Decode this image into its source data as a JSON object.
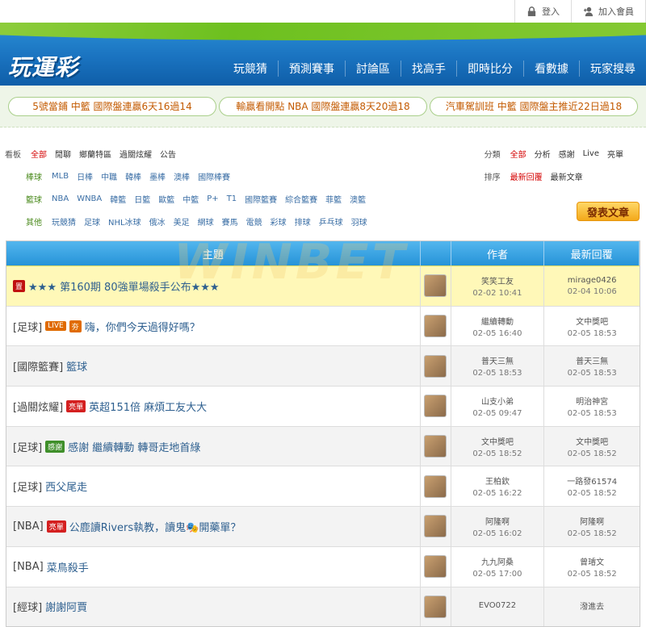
{
  "top": {
    "login": "登入",
    "register": "加入會員"
  },
  "header": {
    "logo": "玩運彩"
  },
  "nav": [
    "玩競猜",
    "預測賽事",
    "討論區",
    "找高手",
    "即時比分",
    "看數據",
    "玩家搜尋"
  ],
  "promos": [
    "5號當鋪 中籃 國際盤連贏6天16過14",
    "輸贏看開點 NBA 國際盤連贏8天20過18",
    "汽車駕訓班 中籃 國際盤主推近22日過18"
  ],
  "filters": {
    "board_label": "看板",
    "board": [
      "全部",
      "閒聊",
      "鄉蘭特區",
      "過關炫耀",
      "公告"
    ],
    "baseball_label": "棒球",
    "baseball": [
      "MLB",
      "日棒",
      "中職",
      "韓棒",
      "墨棒",
      "澳棒",
      "國際棒賽"
    ],
    "basketball_label": "籃球",
    "basketball": [
      "NBA",
      "WNBA",
      "韓籃",
      "日籃",
      "歐籃",
      "中籃",
      "P+",
      "T1",
      "國際籃賽",
      "綜合籃賽",
      "菲籃",
      "澳籃"
    ],
    "other_label": "其他",
    "other": [
      "玩競猜",
      "足球",
      "NHL冰球",
      "俄冰",
      "美足",
      "網球",
      "賽馬",
      "電競",
      "彩球",
      "排球",
      "乒乓球",
      "羽球"
    ],
    "class_label": "分類",
    "class": [
      "全部",
      "分析",
      "感謝",
      "Live",
      "亮單"
    ],
    "sort_label": "排序",
    "sort": [
      "最新回覆",
      "最新文章"
    ]
  },
  "post_button": "發表文章",
  "table": {
    "headers": [
      "主題",
      "",
      "作者",
      "最新回覆"
    ],
    "rows": [
      {
        "cat": "",
        "badges": [
          "置"
        ],
        "title": "★★★ 第160期 80強單場殺手公布★★★",
        "author": "笑笑工友",
        "author_time": "02-02 10:41",
        "reply": "mirage0426",
        "reply_time": "02-04 10:06"
      },
      {
        "cat": "[足球]",
        "badges": [
          "LIVE",
          "夯"
        ],
        "title": "嗨，你們今天過得好嗎？",
        "author": "繼續轉動",
        "author_time": "02-05 16:40",
        "reply": "文中獎吧",
        "reply_time": "02-05 18:53"
      },
      {
        "cat": "[國際籃賽]",
        "badges": [],
        "title": "籃球",
        "author": "普天三無",
        "author_time": "02-05 18:53",
        "reply": "普天三無",
        "reply_time": "02-05 18:53"
      },
      {
        "cat": "[過關炫耀]",
        "badges": [
          "亮單"
        ],
        "title": "英超151倍 麻煩工友大大",
        "author": "山支小弟",
        "author_time": "02-05 09:47",
        "reply": "明治神宮",
        "reply_time": "02-05 18:53"
      },
      {
        "cat": "[足球]",
        "badges": [
          "感謝"
        ],
        "title": "感謝 繼續轉動 轉哥走地首綠",
        "author": "文中獎吧",
        "author_time": "02-05 18:52",
        "reply": "文中獎吧",
        "reply_time": "02-05 18:52"
      },
      {
        "cat": "[足球]",
        "badges": [],
        "title": "西父尾走",
        "author": "王柏欽",
        "author_time": "02-05 16:22",
        "reply": "一路發61574",
        "reply_time": "02-05 18:52"
      },
      {
        "cat": "[NBA]",
        "badges": [
          "亮單"
        ],
        "title": "公鹿讀Rivers執教，讀鬼🎭開藥單？",
        "author": "阿隆啊",
        "author_time": "02-05 16:02",
        "reply": "阿隆啊",
        "reply_time": "02-05 18:52"
      },
      {
        "cat": "[NBA]",
        "badges": [],
        "title": "菜鳥殺手",
        "author": "九九阿桑",
        "author_time": "02-05 17:00",
        "reply": "曾璿文",
        "reply_time": "02-05 18:52"
      },
      {
        "cat": "[經球]",
        "badges": [],
        "title": "謝謝阿賈",
        "author": "EVO0722",
        "author_time": "",
        "reply": "潑進去",
        "reply_time": ""
      }
    ]
  },
  "watermark": "WINBET"
}
